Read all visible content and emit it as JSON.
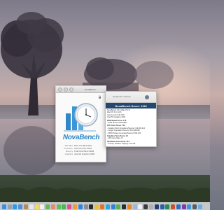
{
  "nova_window": {
    "title": "NovaBench",
    "app_name": "NovaBench",
    "specs": [
      {
        "key": "Mac Mini",
        "value": "Mac mini (Mid 2011)"
      },
      {
        "key": "Processor",
        "value": "Intel Core i5 2.3GHz"
      },
      {
        "key": "Memory",
        "value": "8 GB 1333 MHz DDR3"
      },
      {
        "key": "Graphics",
        "value": "Intel HD Graphics 3000"
      }
    ]
  },
  "score_window": {
    "top_text": "Novabench 3.0 Result",
    "header": "NovaBench Score: 1118",
    "lines": [
      {
        "text": "NovaBench 3.0.8 (Mac OS X)",
        "head": false
      },
      {
        "text": "Mac OS X 10.10.5",
        "head": false
      },
      {
        "text": "Intel Core i5 2.30 GHz",
        "head": false
      },
      {
        "text": "Intel HD Graphics 3000",
        "head": false
      },
      {
        "text": "RAM Speed Score: 176",
        "head": true
      },
      {
        "text": "- RAM Speed: 8128 MB/s",
        "head": false
      },
      {
        "text": "CPU Tests Score: 715",
        "head": true
      },
      {
        "text": "- Floating Point Operations/Second: 118,486,214",
        "head": false
      },
      {
        "text": "- Integer Operations/Second: 351,098,848",
        "head": false
      },
      {
        "text": "- MD5 Hashes Generated/Second: 894,150",
        "head": false
      },
      {
        "text": "Graphics Tests Score: 13",
        "head": true
      },
      {
        "text": "- 3D Frame Rate: 17",
        "head": false
      },
      {
        "text": "Hardware Tests Score: 214",
        "head": true
      },
      {
        "text": "- Primary Partition Capacity: 931 GB",
        "head": false
      }
    ]
  },
  "dock": {
    "icons": [
      {
        "name": "finder-icon",
        "color": "#3d8fe0"
      },
      {
        "name": "launchpad-icon",
        "color": "#9aa3ad"
      },
      {
        "name": "safari-icon",
        "color": "#2d9be0"
      },
      {
        "name": "mail-icon",
        "color": "#4a90d9"
      },
      {
        "name": "contacts-icon",
        "color": "#b58a5a"
      },
      {
        "name": "calendar-icon",
        "color": "#e8e8e8"
      },
      {
        "name": "notes-icon",
        "color": "#f3d65a"
      },
      {
        "name": "reminders-icon",
        "color": "#f0f0f0"
      },
      {
        "name": "maps-icon",
        "color": "#6fb35a"
      },
      {
        "name": "photos-icon",
        "color": "#e78a6a"
      },
      {
        "name": "messages-icon",
        "color": "#5ac15a"
      },
      {
        "name": "facetime-icon",
        "color": "#4cb84c"
      },
      {
        "name": "itunes-icon",
        "color": "#e04f8f"
      },
      {
        "name": "ibooks-icon",
        "color": "#f39c32"
      },
      {
        "name": "app-store-icon",
        "color": "#2f86e0"
      },
      {
        "name": "system-preferences-icon",
        "color": "#8a8f96"
      },
      {
        "name": "terminal-icon",
        "color": "#2b2b2b"
      },
      {
        "name": "chrome-icon",
        "color": "#e4c23c"
      },
      {
        "name": "firefox-icon",
        "color": "#e0722f"
      },
      {
        "name": "skype-icon",
        "color": "#2aa9e0"
      },
      {
        "name": "dropbox-icon",
        "color": "#3a7fd6"
      },
      {
        "name": "evernote-icon",
        "color": "#57b84a"
      },
      {
        "name": "spotify-icon",
        "color": "#2e2e2e"
      },
      {
        "name": "vlc-icon",
        "color": "#e88a23"
      },
      {
        "name": "preview-icon",
        "color": "#a0b9d2"
      },
      {
        "name": "textedit-icon",
        "color": "#f1f1f1"
      },
      {
        "name": "activity-monitor-icon",
        "color": "#3b3b3b"
      },
      {
        "name": "disk-utility-icon",
        "color": "#b0b0b0"
      },
      {
        "name": "photoshop-icon",
        "color": "#1f3f6e"
      },
      {
        "name": "word-icon",
        "color": "#2a5ea8"
      },
      {
        "name": "excel-icon",
        "color": "#2f8a45"
      },
      {
        "name": "powerpoint-icon",
        "color": "#c8532b"
      },
      {
        "name": "outlook-icon",
        "color": "#2f6fc0"
      },
      {
        "name": "onenote-icon",
        "color": "#7b3ea6"
      },
      {
        "name": "novabench-icon",
        "color": "#3d98d6"
      },
      {
        "name": "calculator-icon",
        "color": "#5c5c5c"
      },
      {
        "name": "folder-downloads-icon",
        "color": "#6aaee8"
      },
      {
        "name": "trash-icon",
        "color": "#c7c7c7"
      }
    ]
  }
}
